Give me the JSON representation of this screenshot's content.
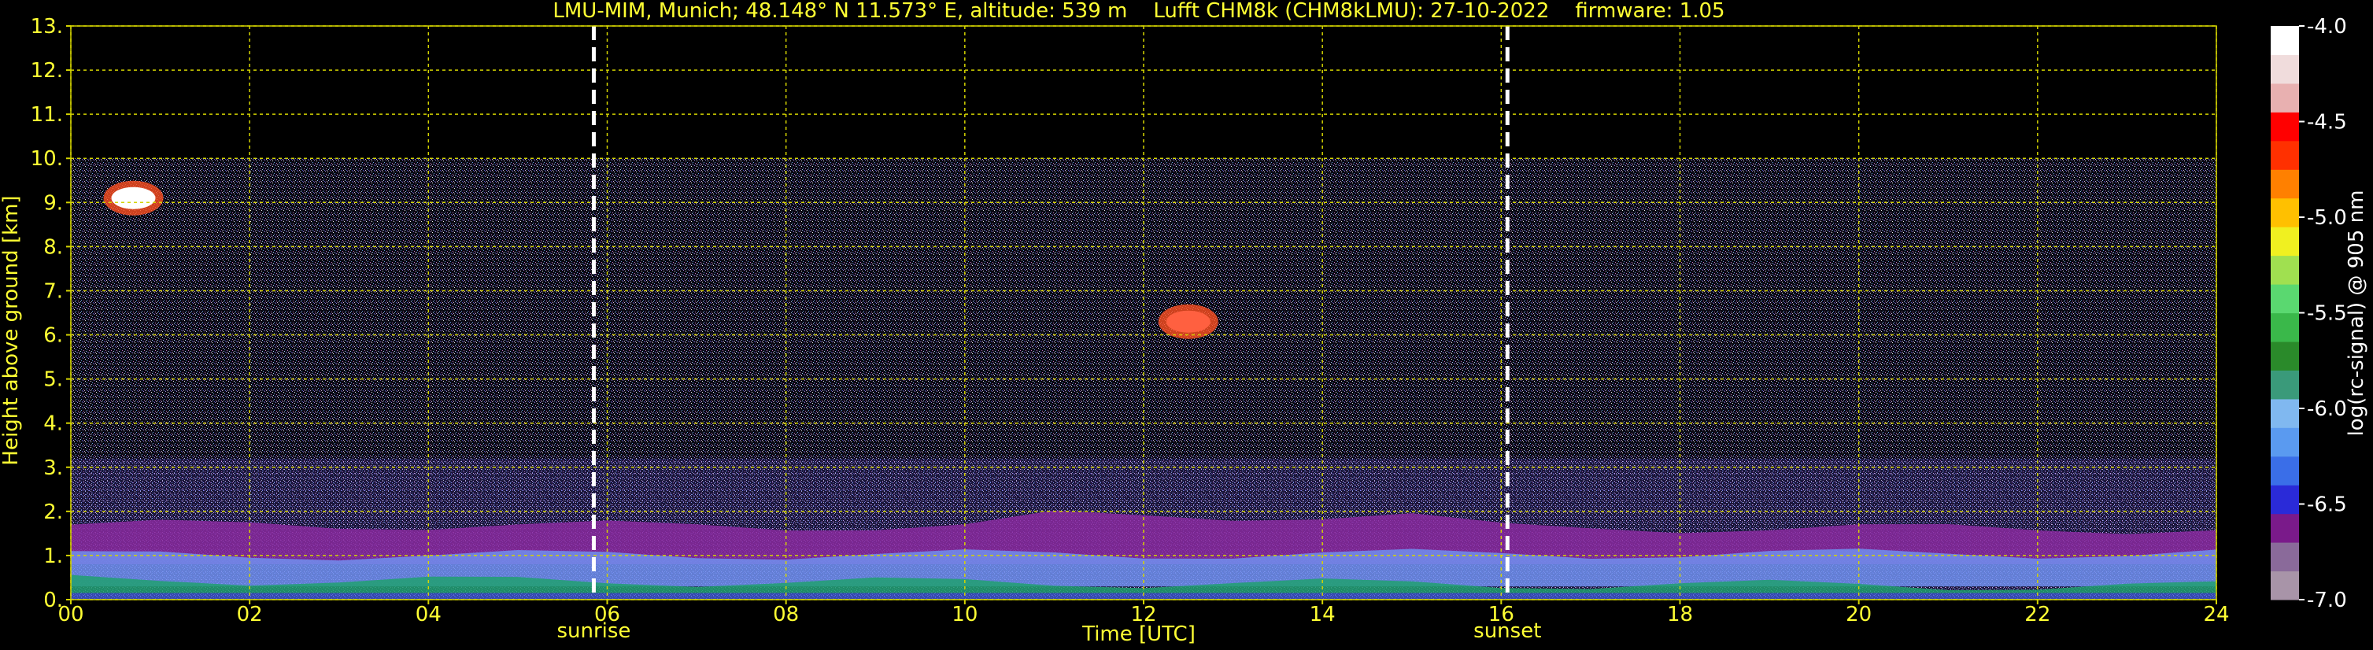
{
  "chart_data": {
    "type": "heatmap",
    "title": "LMU-MIM, Munich; 48.148° N 11.573° E, altitude: 539 m    Lufft CHM8k (CHM8kLMU): 27-10-2022    firmware: 1.05",
    "xlabel": "Time [UTC]",
    "ylabel": "Height above ground [km]",
    "xlim": [
      0,
      24
    ],
    "ylim": [
      0,
      13
    ],
    "x_ticks": [
      "00",
      "02",
      "04",
      "06",
      "08",
      "10",
      "12",
      "14",
      "16",
      "18",
      "20",
      "22",
      "24"
    ],
    "y_ticks": [
      "0.",
      "1.",
      "2.",
      "3.",
      "4.",
      "5.",
      "6.",
      "7.",
      "8.",
      "9.",
      "10.",
      "11.",
      "12.",
      "13."
    ],
    "grid": true,
    "grid_color": "#d4d400",
    "events": [
      {
        "label": "sunrise",
        "time": 5.85
      },
      {
        "label": "sunset",
        "time": 16.07
      }
    ],
    "data_top_km": 10.0,
    "colorbar": {
      "label": "log(rc-signal) @ 905 nm",
      "min": -7.0,
      "max": -4.0,
      "ticks": [
        "-4.0",
        "-4.5",
        "-5.0",
        "-5.5",
        "-6.0",
        "-6.5",
        "-7.0"
      ],
      "colors": [
        "#a894a8",
        "#8a6a9a",
        "#7a1a8a",
        "#2a2ad8",
        "#3a6ee8",
        "#5a9af0",
        "#80b8f0",
        "#3a9a7a",
        "#2a8a2a",
        "#3ab84a",
        "#5ad870",
        "#a0e050",
        "#f0f020",
        "#ffc000",
        "#ff8000",
        "#ff3000",
        "#ff0000",
        "#e8b0b0",
        "#f0dcdc",
        "#ffffff"
      ]
    },
    "layers": [
      {
        "description_color": "#20a070",
        "bottom_km": 0.15,
        "top_km_start": 0.45,
        "top_km_end": 0.3
      },
      {
        "description_color": "#7090f0",
        "bottom_km": 0.3,
        "top_km_start": 1.0,
        "top_km_end": 1.05
      },
      {
        "description_color": "#8a2aa0",
        "bottom_km": 0.8,
        "top_km_start": 1.7,
        "top_km_end": 1.6
      }
    ],
    "clouds": [
      {
        "time": 0.7,
        "height_km": 9.1,
        "color": "#ffffff"
      },
      {
        "time": 12.5,
        "height_km": 6.3,
        "color": "#ff6040"
      }
    ]
  }
}
